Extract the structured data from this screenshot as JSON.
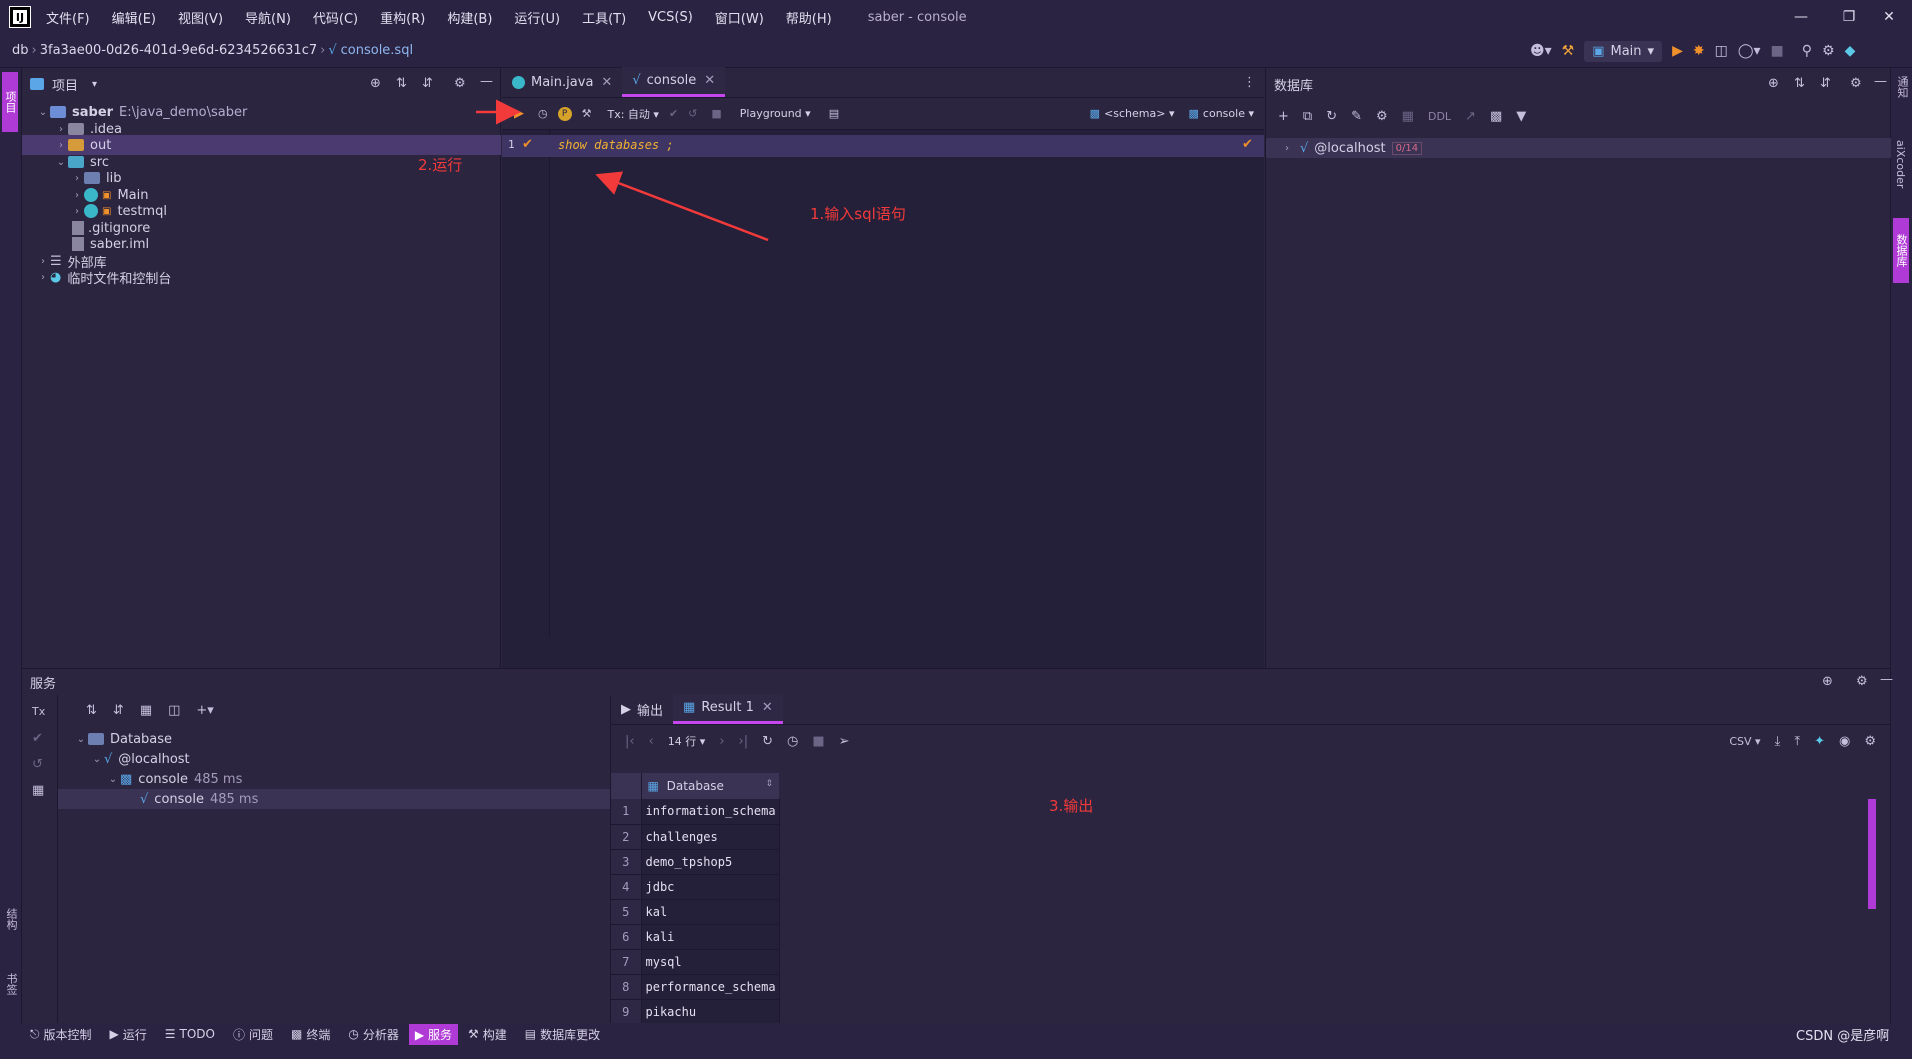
{
  "menubar": {
    "items": [
      "文件(F)",
      "编辑(E)",
      "视图(V)",
      "导航(N)",
      "代码(C)",
      "重构(R)",
      "构建(B)",
      "运行(U)",
      "工具(T)",
      "VCS(S)",
      "窗口(W)",
      "帮助(H)"
    ],
    "window_title": "saber - console"
  },
  "navbar": {
    "crumbs": [
      "db",
      "3fa3ae00-0d26-401d-9e6d-6234526631c7",
      "console.sql"
    ],
    "run_config": "Main"
  },
  "project": {
    "title": "项目",
    "tree": [
      {
        "label": "saber",
        "extra": "E:\\java_demo\\saber"
      },
      {
        "label": ".idea"
      },
      {
        "label": "out"
      },
      {
        "label": "src"
      },
      {
        "label": "lib"
      },
      {
        "label": "Main"
      },
      {
        "label": "testmql"
      },
      {
        "label": ".gitignore"
      },
      {
        "label": "saber.iml"
      },
      {
        "label": "外部库"
      },
      {
        "label": "临时文件和控制台"
      }
    ]
  },
  "editor": {
    "tabs": [
      "Main.java",
      "console"
    ],
    "toolbar": {
      "tx": "Tx: 自动",
      "playground": "Playground",
      "schema": "<schema>",
      "session": "console"
    },
    "line_number": "1",
    "code": "show databases ;"
  },
  "database": {
    "title": "数据库",
    "ddl": "DDL",
    "host": "@localhost",
    "host_badge": "0/14"
  },
  "annotations": {
    "step1": "1.输入sql语句",
    "step2": "2.运行",
    "step3": "3.输出"
  },
  "services": {
    "title": "服务",
    "tree": [
      {
        "label": "Database"
      },
      {
        "label": "@localhost"
      },
      {
        "label": "console",
        "time": "485 ms"
      },
      {
        "label": "console",
        "time": "485 ms"
      }
    ],
    "tabs": [
      "输出",
      "Result 1"
    ],
    "rows_label": "14 行",
    "export": "CSV",
    "column": "Database",
    "rows": [
      {
        "n": "1",
        "v": "information_schema"
      },
      {
        "n": "2",
        "v": "challenges"
      },
      {
        "n": "3",
        "v": "demo_tpshop5"
      },
      {
        "n": "4",
        "v": "jdbc"
      },
      {
        "n": "5",
        "v": "kal"
      },
      {
        "n": "6",
        "v": "kali"
      },
      {
        "n": "7",
        "v": "mysql"
      },
      {
        "n": "8",
        "v": "performance_schema"
      },
      {
        "n": "9",
        "v": "pikachu"
      }
    ]
  },
  "bottombar": {
    "items": [
      "版本控制",
      "运行",
      "TODO",
      "问题",
      "终端",
      "分析器",
      "服务",
      "构建",
      "数据库更改"
    ]
  },
  "left_strip": {
    "top": "项目",
    "bottom1": "结构",
    "bottom2": "书签"
  },
  "right_strip": {
    "top": "通知",
    "mid": "aiXcoder",
    "db": "数据库"
  },
  "watermark": "CSDN @是彦啊"
}
